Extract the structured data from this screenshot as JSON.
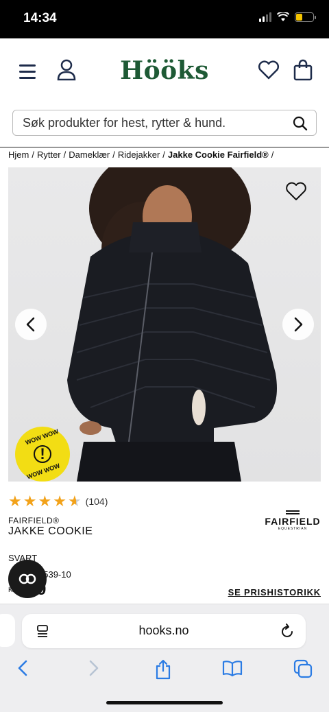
{
  "status_bar": {
    "time": "14:34"
  },
  "header": {
    "logo": "Hööks"
  },
  "search": {
    "placeholder": "Søk produkter for hest, rytter & hund."
  },
  "breadcrumb": {
    "items": [
      "Hjem",
      "Rytter",
      "Dameklær",
      "Ridejakker"
    ],
    "current": "Jakke Cookie Fairfield®",
    "separator": "/"
  },
  "gallery": {
    "badge_top": "WOW WOW",
    "badge_mark": "!",
    "badge_bottom": "WOW WOW"
  },
  "product": {
    "rating_stars": 4.5,
    "review_count": "(104)",
    "brand": "FAIRFIELD®",
    "name": "JAKKE COOKIE",
    "brand_logo_name": "FAIRFIELD",
    "brand_logo_sub": "EQUESTRIAN",
    "color": "SVART",
    "sku": "1539-10",
    "price_currency": "Kr",
    "price_value": "9",
    "price_history_label": "SE PRISHISTORIKK"
  },
  "browser": {
    "url": "hooks.no"
  },
  "colors": {
    "brand_green": "#1e5a35",
    "star": "#f2a21a",
    "badge_yellow": "#f2dd14"
  }
}
